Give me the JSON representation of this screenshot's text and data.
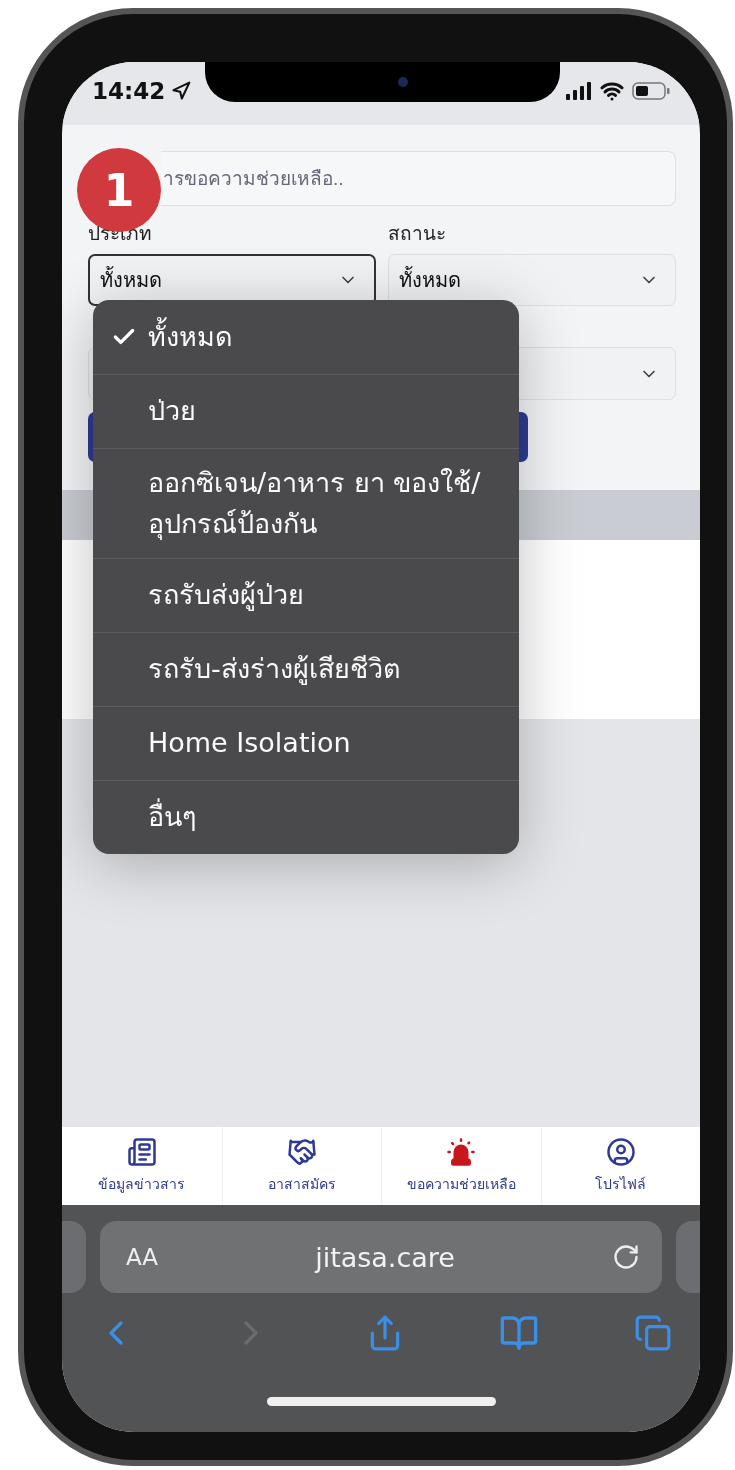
{
  "status_bar": {
    "time": "14:42"
  },
  "step_badge": "1",
  "search": {
    "placeholder": "ารขอความช่วยเหลือ.."
  },
  "filters": [
    {
      "label": "ประเภท",
      "value": "ทั้งหมด",
      "focused": true
    },
    {
      "label": "สถานะ",
      "value": "ทั้งหมด",
      "focused": false
    }
  ],
  "dropdown": {
    "options": [
      {
        "label": "ทั้งหมด",
        "selected": true
      },
      {
        "label": "ป่วย",
        "selected": false
      },
      {
        "label": "ออกซิเจน/อาหาร ยา ของใช้/อุปกรณ์ป้องกัน",
        "selected": false
      },
      {
        "label": "รถรับส่งผู้ป่วย",
        "selected": false
      },
      {
        "label": "รถรับ-ส่งร่างผู้เสียชีวิต",
        "selected": false
      },
      {
        "label": "Home Isolation",
        "selected": false
      },
      {
        "label": "อื่นๆ",
        "selected": false
      }
    ]
  },
  "tab_bar": [
    {
      "label": "ข้อมูลข่าวสาร",
      "selected": false
    },
    {
      "label": "อาสาสมัคร",
      "selected": false
    },
    {
      "label": "ขอความช่วยเหลือ",
      "selected": true
    },
    {
      "label": "โปรไฟล์",
      "selected": false
    }
  ],
  "browser": {
    "text_size": "AA",
    "url": "jitasa.care",
    "forward_disabled": true
  }
}
